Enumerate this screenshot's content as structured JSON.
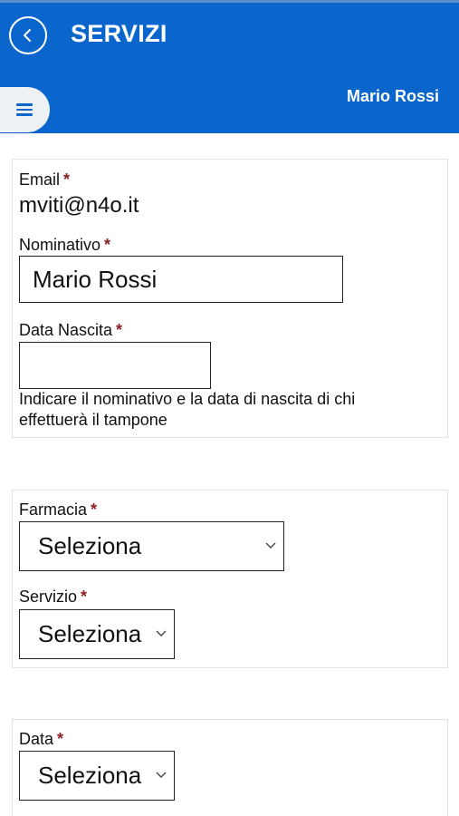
{
  "header": {
    "title": "SERVIZI",
    "user_name": "Mario Rossi",
    "color": "#0a66cc"
  },
  "form": {
    "email": {
      "label": "Email",
      "required_mark": "*",
      "value": "mviti@n4o.it"
    },
    "nominativo": {
      "label": "Nominativo",
      "required_mark": "*",
      "value": "Mario Rossi"
    },
    "data_nascita": {
      "label": "Data Nascita",
      "required_mark": "*",
      "value": ""
    },
    "hint": "Indicare il nominativo e la data di nascita di chi effettuerà il tampone",
    "farmacia": {
      "label": "Farmacia",
      "required_mark": "*",
      "selected": "Seleziona"
    },
    "servizio": {
      "label": "Servizio",
      "required_mark": "*",
      "selected": "Seleziona"
    },
    "data": {
      "label": "Data",
      "required_mark": "*",
      "selected": "Seleziona"
    }
  },
  "icons": {
    "back": "chevron-left-icon",
    "menu": "hamburger-menu-icon",
    "dropdown": "chevron-down-icon"
  },
  "colors": {
    "required_mark": "#8b2020",
    "card_border": "#e2e2e2"
  }
}
